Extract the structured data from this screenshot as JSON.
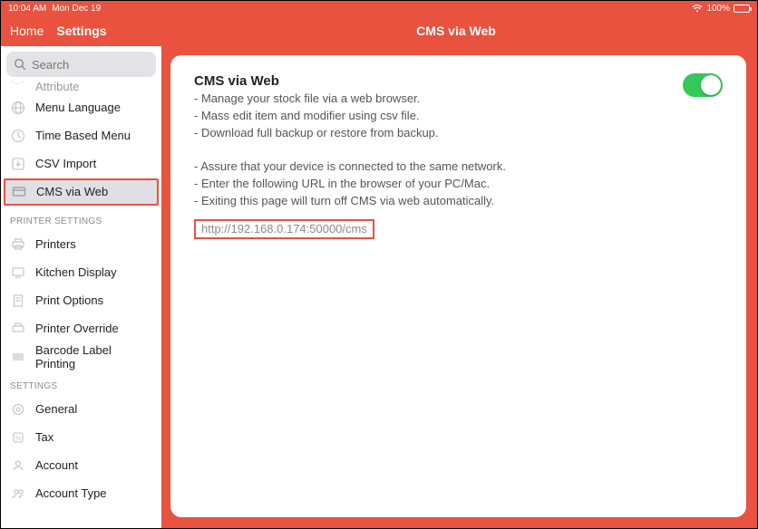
{
  "statusbar": {
    "time": "10:04 AM",
    "date": "Mon Dec 19",
    "battery_pct": "100%"
  },
  "navbar": {
    "home": "Home",
    "settings": "Settings",
    "title": "CMS via Web"
  },
  "search": {
    "placeholder": "Search"
  },
  "sidebar": {
    "partial_top": "Attribute",
    "items_top": [
      {
        "label": "Menu Language"
      },
      {
        "label": "Time Based Menu"
      },
      {
        "label": "CSV Import"
      },
      {
        "label": "CMS via Web",
        "selected": true
      }
    ],
    "section_printer": "PRINTER SETTINGS",
    "items_printer": [
      {
        "label": "Printers"
      },
      {
        "label": "Kitchen Display"
      },
      {
        "label": "Print Options"
      },
      {
        "label": "Printer Override"
      },
      {
        "label": "Barcode Label Printing"
      }
    ],
    "section_settings": "SETTINGS",
    "items_settings": [
      {
        "label": "General"
      },
      {
        "label": "Tax"
      },
      {
        "label": "Account"
      },
      {
        "label": "Account Type"
      }
    ]
  },
  "main": {
    "title": "CMS via Web",
    "lines": [
      "- Manage your stock file via a web browser.",
      "- Mass edit item and modifier using csv file.",
      "- Download full backup or restore from backup.",
      "",
      "- Assure that your device is connected to the same network.",
      "- Enter the following URL in the browser of your PC/Mac.",
      "- Exiting this page will turn off CMS via web automatically."
    ],
    "url": "http://192.168.0.174:50000/cms",
    "toggle_on": true
  }
}
